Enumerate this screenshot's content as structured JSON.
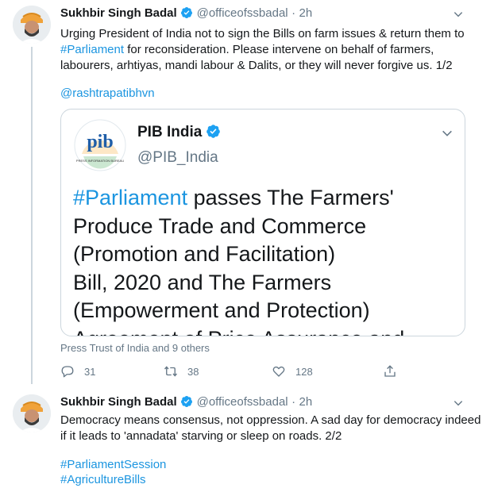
{
  "tweet1": {
    "author_name": "Sukhbir Singh Badal",
    "author_handle": "@officeofssbadal",
    "separator": "·",
    "time": "2h",
    "text_part1": "Urging President of India not to sign the Bills on farm issues & return them to ",
    "text_hashtag": "#Parliament",
    "text_part2": " for reconsideration. Please intervene on behalf of farmers, labourers, arhtiyas, mandi labour & Dalits, or they will never forgive us. 1/2",
    "mention": "@rashtrapatibhvn",
    "quoted": {
      "name": "PIB India",
      "handle": "@PIB_India",
      "hashtag": "#Parliament",
      "text_line1": " passes The Farmers'",
      "text_line2": "Produce Trade and Commerce",
      "text_line3": "(Promotion and Facilitation)",
      "text_line4": "Bill, 2020 and The Farmers",
      "text_line5": "(Empowerment and Protection)",
      "text_line6": "Agreement of Price Assurance and",
      "logo_text": "pib",
      "logo_caption": "PRESS INFORMATION BUREAU"
    },
    "retweeted_by": "Press Trust of India and 9 others",
    "replies": "31",
    "retweets": "38",
    "likes": "128"
  },
  "tweet2": {
    "author_name": "Sukhbir Singh Badal",
    "author_handle": "@officeofssbadal",
    "separator": "·",
    "time": "2h",
    "text": "Democracy means consensus, not oppression. A sad day for democracy indeed if it leads to 'annadata' starving or sleep on roads. 2/2",
    "hashtag1": "#ParliamentSession",
    "hashtag2": "#AgricultureBills"
  },
  "colors": {
    "link": "#1b95e0",
    "verified": "#1da1f2",
    "secondary": "#657786",
    "border": "#ccd6dd"
  },
  "icons": [
    "verified-badge-icon",
    "chevron-down-icon",
    "reply-icon",
    "retweet-icon",
    "like-icon",
    "share-icon"
  ]
}
